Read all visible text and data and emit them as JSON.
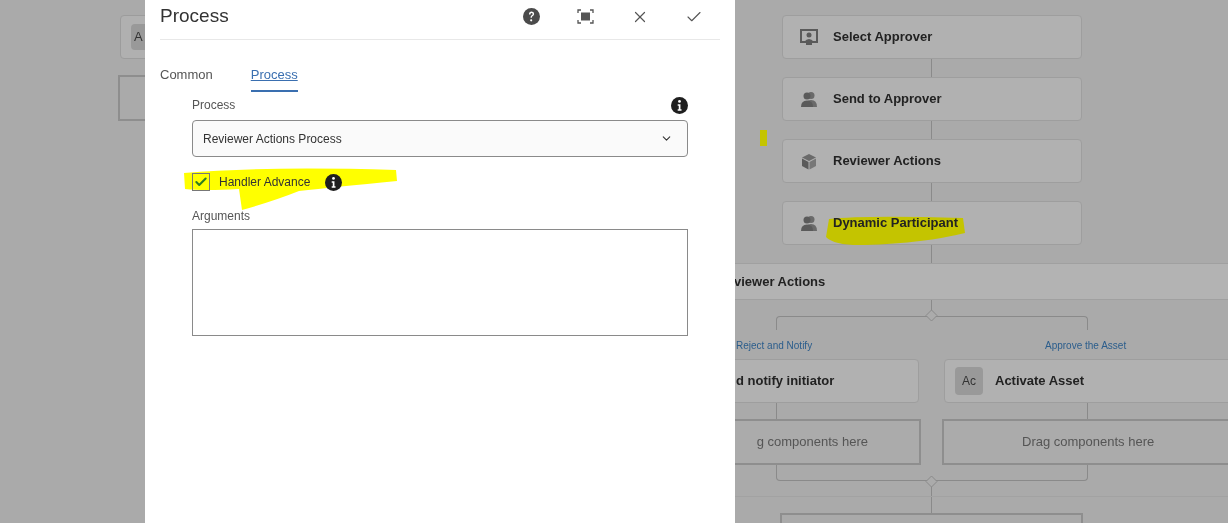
{
  "background_card": {
    "tile": "A"
  },
  "dialog": {
    "title": "Process",
    "tabs": [
      {
        "label": "Common",
        "selected": false
      },
      {
        "label": "Process",
        "selected": true
      }
    ],
    "process_field": {
      "label": "Process",
      "value": "Reviewer Actions Process"
    },
    "handler_advance": {
      "label": "Handler Advance",
      "checked": true
    },
    "arguments_field": {
      "label": "Arguments"
    }
  },
  "workflow": {
    "steps": [
      {
        "label": "Select Approver",
        "kind": "screen-user"
      },
      {
        "label": "Send to Approver",
        "kind": "user"
      },
      {
        "label": "Reviewer Actions",
        "kind": "box"
      },
      {
        "label": "Dynamic Participant",
        "kind": "user"
      }
    ],
    "section_title": "viewer Actions",
    "branches": [
      {
        "label": "Reject and Notify",
        "step": "d notify initiator",
        "drop_hint": "g components here"
      },
      {
        "label": "Approve the Asset",
        "step": "Activate Asset",
        "tile": "Ac",
        "drop_hint": "Drag components here"
      }
    ]
  }
}
